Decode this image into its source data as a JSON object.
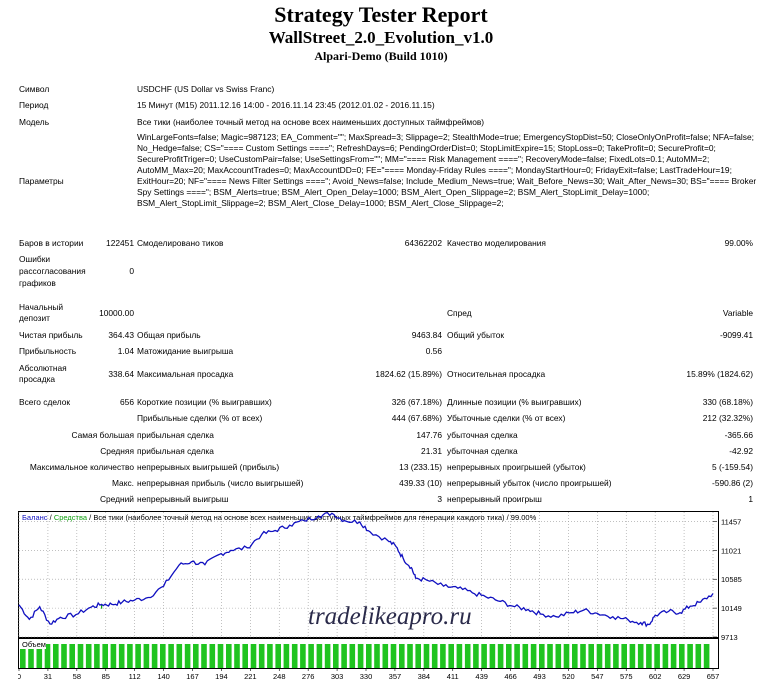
{
  "header": {
    "title": "Strategy Tester Report",
    "ea_name": "WallStreet_2.0_Evolution_v1.0",
    "server": "Alpari-Demo (Build 1010)"
  },
  "info": {
    "symbol_label": "Символ",
    "symbol_value": "USDCHF (US Dollar vs Swiss Franc)",
    "period_label": "Период",
    "period_value": "15 Минут (M15) 2011.12.16 14:00 - 2016.11.14 23:45 (2012.01.02 - 2016.11.15)",
    "model_label": "Модель",
    "model_value": "Все тики (наиболее точный метод на основе всех наименьших доступных таймфреймов)",
    "params_label": "Параметры",
    "params_value": "WinLargeFonts=false; Magic=987123; EA_Comment=\"\"; MaxSpread=3; Slippage=2; StealthMode=true; EmergencyStopDist=50; CloseOnlyOnProfit=false; NFA=false; No_Hedge=false; CS=\"==== Custom Settings ====\"; RefreshDays=6; PendingOrderDist=0; StopLimitExpire=15; StopLoss=0; TakeProfit=0; SecureProfit=0; SecureProfitTriger=0; UseCustomPair=false; UseSettingsFrom=\"\"; MM=\"==== Risk Management ====\"; RecoveryMode=false; FixedLots=0.1; AutoMM=2; AutoMM_Max=20; MaxAccountTrades=0; MaxAccountDD=0; FE=\"==== Monday-Friday Rules ====\"; MondayStartHour=0; FridayExit=false; LastTradeHour=19; ExitHour=20; NF=\"==== News Filter Settings ====\"; Avoid_News=false; Include_Medium_News=true; Wait_Before_News=30; Wait_After_News=30; BS=\"==== Broker Spy Settings ====\"; BSM_Alerts=true; BSM_Alert_Open_Delay=1000; BSM_Alert_Open_Slippage=2; BSM_Alert_StopLimit_Delay=1000; BSM_Alert_StopLimit_Slippage=2; BSM_Alert_Close_Delay=1000; BSM_Alert_Close_Slippage=2;"
  },
  "stats": {
    "bars_label": "Баров в истории",
    "bars_value": "122451",
    "ticks_label": "Смоделировано тиков",
    "ticks_value": "64362202",
    "quality_label": "Качество моделирования",
    "quality_value": "99.00%",
    "errors_label_1": "Ошибки",
    "errors_label_2": "рассогласования",
    "errors_label_3": "графиков",
    "errors_value": "0",
    "deposit_label_1": "Начальный",
    "deposit_label_2": "депозит",
    "deposit_value": "10000.00",
    "spread_label": "Спред",
    "spread_value": "Variable",
    "net_profit_label": "Чистая прибыль",
    "net_profit_value": "364.43",
    "gross_profit_label": "Общая прибыль",
    "gross_profit_value": "9463.84",
    "gross_loss_label": "Общий убыток",
    "gross_loss_value": "-9099.41",
    "profit_factor_label": "Прибыльность",
    "profit_factor_value": "1.04",
    "expected_payoff_label": "Матожидание выигрыша",
    "expected_payoff_value": "0.56",
    "abs_dd_label_1": "Абсолютная",
    "abs_dd_label_2": "просадка",
    "abs_dd_value": "338.64",
    "max_dd_label": "Максимальная просадка",
    "max_dd_value": "1824.62 (15.89%)",
    "rel_dd_label": "Относительная просадка",
    "rel_dd_value": "15.89% (1824.62)",
    "total_trades_label": "Всего сделок",
    "total_trades_value": "656",
    "short_label": "Короткие позиции (% выигравших)",
    "short_value": "326 (67.18%)",
    "long_label": "Длинные позиции (% выигравших)",
    "long_value": "330 (68.18%)",
    "profit_trades_label": "Прибыльные сделки (% от всех)",
    "profit_trades_value": "444 (67.68%)",
    "loss_trades_label": "Убыточные сделки (% от всех)",
    "loss_trades_value": "212 (32.32%)",
    "largest_label_a": "Самая большая",
    "largest_label_b": "прибыльная сделка",
    "largest_profit": "147.76",
    "largest_label_c": "убыточная сделка",
    "largest_loss": "-365.66",
    "average_label_a": "Средняя",
    "average_label_b": "прибыльная сделка",
    "average_profit": "21.31",
    "average_label_c": "убыточная сделка",
    "average_loss": "-42.92",
    "max_consec_label_a": "Максимальное количество",
    "max_consec_label_b": "непрерывных выигрышей (прибыль)",
    "max_consec_wins": "13 (233.15)",
    "max_consec_label_c": "непрерывных проигрышей (убыток)",
    "max_consec_losses": "5 (-159.54)",
    "maximal_label_a": "Макс.",
    "maximal_label_b": "непрерывная прибыль (число выигрышей)",
    "maximal_profit": "439.33 (10)",
    "maximal_label_c": "непрерывный убыток (число проигрышей)",
    "maximal_loss": "-590.86 (2)",
    "avg_consec_label_a": "Средний",
    "avg_consec_label_b": "непрерывный выигрыш",
    "avg_consec_wins": "3",
    "avg_consec_label_c": "непрерывный проигрыш",
    "avg_consec_losses": "1"
  },
  "chart": {
    "legend_balance": "Баланс",
    "legend_sep1": "/",
    "legend_equity": "Средства",
    "legend_sep2": "/",
    "legend_desc": "Все тики (наиболее точный метод на основе всех наименьших доступных таймфреймов для генерации каждого тика) / 99.00%",
    "watermark": "tradelikeapro.ru",
    "volume_label": "Объем",
    "balance_color": "#1010c0",
    "equity_color": "#10a010",
    "volume_color": "#1fc41f"
  },
  "chart_data": {
    "type": "line",
    "y_ticks": [
      11457,
      11021,
      10585,
      10149,
      9713
    ],
    "ylim": [
      9713,
      11600
    ],
    "x_ticks": [
      "0",
      "31",
      "58",
      "85",
      "112",
      "140",
      "167",
      "194",
      "221",
      "248",
      "276",
      "303",
      "330",
      "357",
      "384",
      "411",
      "439",
      "466",
      "493",
      "520",
      "547",
      "575",
      "602",
      "629",
      "657"
    ],
    "xlim": [
      0,
      672
    ],
    "series": [
      {
        "name": "Баланс",
        "x": [
          0,
          10,
          20,
          30,
          40,
          55,
          70,
          80,
          90,
          100,
          112,
          125,
          140,
          155,
          167,
          180,
          194,
          205,
          221,
          235,
          248,
          262,
          276,
          290,
          303,
          315,
          330,
          340,
          357,
          365,
          372,
          380,
          384,
          395,
          411,
          425,
          439,
          452,
          466,
          480,
          493,
          505,
          520,
          535,
          547,
          560,
          575,
          590,
          602,
          610,
          616,
          629,
          640,
          650,
          660,
          672
        ],
        "values": [
          10200,
          9980,
          10170,
          9910,
          10010,
          10050,
          10165,
          10205,
          10205,
          10240,
          10270,
          10310,
          10480,
          10800,
          10850,
          10805,
          10960,
          11020,
          11060,
          11260,
          11320,
          11400,
          11470,
          11540,
          11580,
          11470,
          11450,
          11300,
          11170,
          11080,
          10900,
          10760,
          10600,
          10570,
          10480,
          10450,
          10380,
          10320,
          10250,
          10170,
          10130,
          10060,
          10020,
          10080,
          10120,
          10070,
          10020,
          9970,
          9930,
          9900,
          10040,
          10100,
          10080,
          10180,
          10240,
          10370
        ]
      }
    ],
    "equity_dips": [
      [
        80,
        10140
      ]
    ],
    "volume": "uniform"
  }
}
